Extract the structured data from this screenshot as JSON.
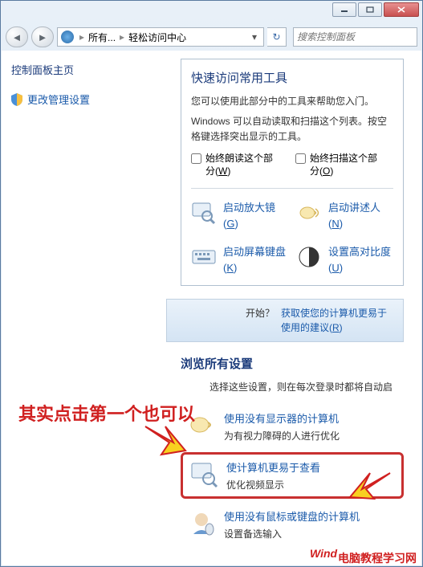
{
  "window": {
    "minimize": "–",
    "maximize": "▢",
    "close": "✕"
  },
  "breadcrumb": {
    "item1": "所有...",
    "item2": "轻松访问中心"
  },
  "search": {
    "placeholder": "搜索控制面板"
  },
  "sidebar": {
    "title": "控制面板主页",
    "link1": "更改管理设置"
  },
  "panel": {
    "title": "快速访问常用工具",
    "p1": "您可以使用此部分中的工具来帮助您入门。",
    "p2": "Windows 可以自动读取和扫描这个列表。按空格键选择突出显示的工具。",
    "chk1_a": "始终朗读这个部分(",
    "chk1_u": "W",
    "chk1_b": ")",
    "chk2_a": "始终扫描这个部分(",
    "chk2_u": "O",
    "chk2_b": ")",
    "g1_a": "启动放大镜(",
    "g1_u": "G",
    "g1_b": ")",
    "g2_a": "启动讲述人(",
    "g2_u": "N",
    "g2_b": ")",
    "g3_a": "启动屏幕键盘(",
    "g3_u": "K",
    "g3_b": ")",
    "g4_a": "设置高对比度(",
    "g4_u": "U",
    "g4_b": ")"
  },
  "help": {
    "left_a": "开始？",
    "right_a": "获取使您的计算机更易于使用的建议(",
    "right_u": "R",
    "right_b": ")"
  },
  "browse": {
    "title": "浏览所有设置",
    "desc": "选择这些设置，则在每次登录时都将自动启"
  },
  "items": [
    {
      "title": "使用没有显示器的计算机",
      "desc": "为有视力障碍的人进行优化"
    },
    {
      "title": "使计算机更易于查看",
      "desc": "优化视频显示"
    },
    {
      "title": "使用没有鼠标或键盘的计算机",
      "desc": "设置备选输入"
    }
  ],
  "annotation": {
    "text": "其实点击第一个也可以",
    "wm1": "Wind",
    "wm2": "电脑教程学习网"
  }
}
